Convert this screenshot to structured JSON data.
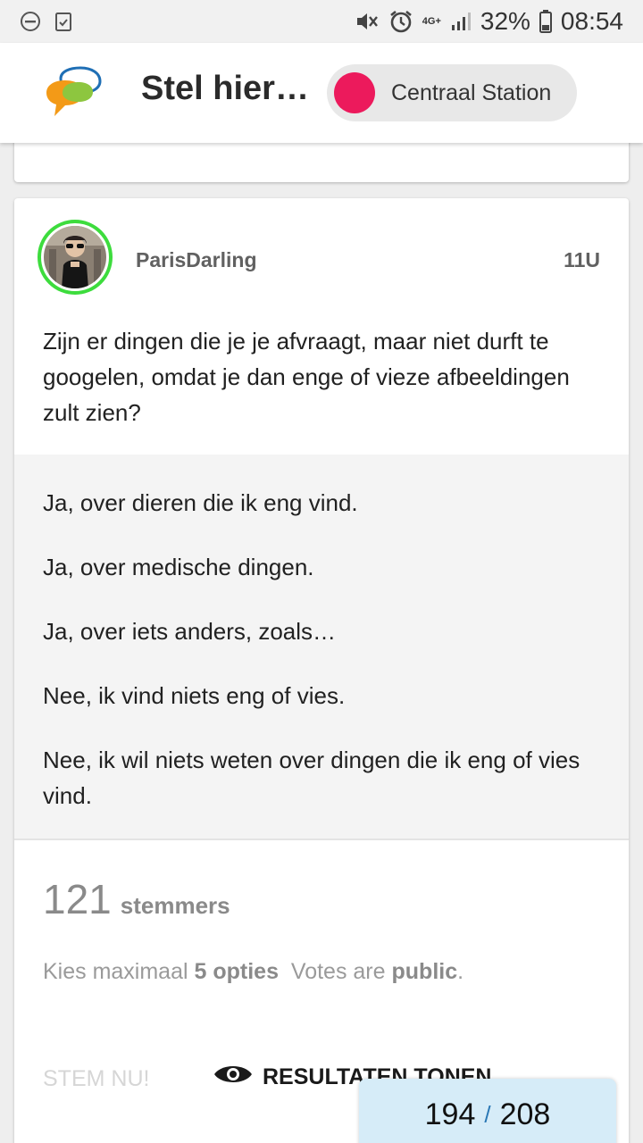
{
  "status_bar": {
    "battery": "32%",
    "time": "08:54",
    "network": "4G+"
  },
  "header": {
    "title": "Stel hier…",
    "location_chip": "Centraal Station",
    "chip_color": "#ec1a5c"
  },
  "post": {
    "username": "ParisDarling",
    "time": "11U",
    "avatar_border": "#3ddc3d",
    "question": "Zijn er dingen die je je afvraagt, maar niet durft te googelen, omdat je dan enge of vieze afbeeldingen zult zien?",
    "options": [
      "Ja, over dieren die ik eng vind.",
      "Ja, over medische dingen.",
      "Ja, over iets anders, zoals…",
      "Nee, ik vind niets eng of vies.",
      "Nee, ik wil niets weten over dingen die ik eng of vies vind."
    ],
    "voters_count": "121",
    "voters_label": "stemmers",
    "rules_prefix": "Kies maximaal",
    "rules_max": "5 opties",
    "rules_votes": "Votes are",
    "rules_visibility": "public",
    "rules_end": ".",
    "vote_button": "STEM NU!",
    "results_button": "RESULTATEN TONEN"
  },
  "pager": {
    "current": "194",
    "separator": "/",
    "total": "208"
  }
}
